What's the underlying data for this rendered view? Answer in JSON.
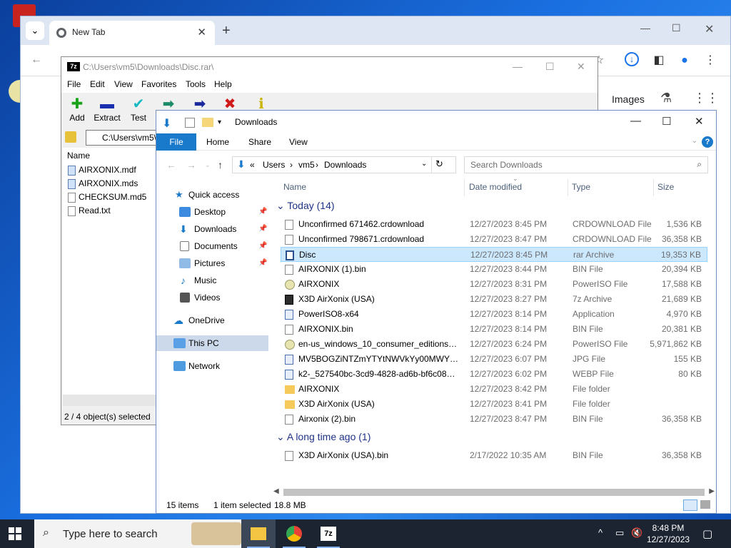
{
  "chrome": {
    "tab_title": "New Tab",
    "images_link": "Images"
  },
  "sevenzip": {
    "title": "C:\\Users\\vm5\\Downloads\\Disc.rar\\",
    "logo_text": "7z",
    "menu": [
      "File",
      "Edit",
      "View",
      "Favorites",
      "Tools",
      "Help"
    ],
    "tools": [
      {
        "label": "Add",
        "glyph": "✚",
        "color": "#19a319"
      },
      {
        "label": "Extract",
        "glyph": "▬",
        "color": "#1a2fb0"
      },
      {
        "label": "Test",
        "glyph": "✔",
        "color": "#16b9c4"
      },
      {
        "label": "",
        "glyph": "➡",
        "color": "#1d8b6a"
      },
      {
        "label": "",
        "glyph": "➡",
        "color": "#1a2a9e"
      },
      {
        "label": "",
        "glyph": "✖",
        "color": "#d11b1b"
      },
      {
        "label": "",
        "glyph": "ℹ",
        "color": "#c9b400"
      }
    ],
    "address": "C:\\Users\\vm5\\",
    "column_name": "Name",
    "files": [
      {
        "name": "AIRXONIX.mdf",
        "kind": "disc"
      },
      {
        "name": "AIRXONIX.mds",
        "kind": "disc"
      },
      {
        "name": "CHECKSUM.md5",
        "kind": "txt"
      },
      {
        "name": "Read.txt",
        "kind": "txt"
      }
    ],
    "status": "2 / 4 object(s) selected"
  },
  "explorer": {
    "title": "Downloads",
    "ribbon": {
      "file": "File",
      "home": "Home",
      "share": "Share",
      "view": "View"
    },
    "address": {
      "prefix": "«",
      "parts": [
        "Users",
        "vm5",
        "Downloads"
      ]
    },
    "search_placeholder": "Search Downloads",
    "nav": {
      "quick_access": "Quick access",
      "desktop": "Desktop",
      "downloads": "Downloads",
      "documents": "Documents",
      "pictures": "Pictures",
      "music": "Music",
      "videos": "Videos",
      "onedrive": "OneDrive",
      "this_pc": "This PC",
      "network": "Network"
    },
    "columns": {
      "name": "Name",
      "date": "Date modified",
      "type": "Type",
      "size": "Size"
    },
    "groups": [
      {
        "label": "Today (14)",
        "rows": [
          {
            "name": "Unconfirmed 671462.crdownload",
            "date": "12/27/2023 8:45 PM",
            "type": "CRDOWNLOAD File",
            "size": "1,536 KB",
            "icon": "doc"
          },
          {
            "name": "Unconfirmed 798671.crdownload",
            "date": "12/27/2023 8:47 PM",
            "type": "CRDOWNLOAD File",
            "size": "36,358 KB",
            "icon": "doc"
          },
          {
            "name": "Disc",
            "date": "12/27/2023 8:45 PM",
            "type": "rar Archive",
            "size": "19,353 KB",
            "icon": "rar",
            "selected": true
          },
          {
            "name": "AIRXONIX (1).bin",
            "date": "12/27/2023 8:44 PM",
            "type": "BIN File",
            "size": "20,394 KB",
            "icon": "doc"
          },
          {
            "name": "AIRXONIX",
            "date": "12/27/2023 8:31 PM",
            "type": "PowerISO File",
            "size": "17,588 KB",
            "icon": "disc"
          },
          {
            "name": "X3D AirXonix (USA)",
            "date": "12/27/2023 8:27 PM",
            "type": "7z Archive",
            "size": "21,689 KB",
            "icon": "zip"
          },
          {
            "name": "PowerISO8-x64",
            "date": "12/27/2023 8:14 PM",
            "type": "Application",
            "size": "4,970 KB",
            "icon": "img"
          },
          {
            "name": "AIRXONIX.bin",
            "date": "12/27/2023 8:14 PM",
            "type": "BIN File",
            "size": "20,381 KB",
            "icon": "doc"
          },
          {
            "name": "en-us_windows_10_consumer_editions_v...",
            "date": "12/27/2023 6:24 PM",
            "type": "PowerISO File",
            "size": "5,971,862 KB",
            "icon": "disc"
          },
          {
            "name": "MV5BOGZiNTZmYTYtNWVkYy00MWY0L...",
            "date": "12/27/2023 6:07 PM",
            "type": "JPG File",
            "size": "155 KB",
            "icon": "img"
          },
          {
            "name": "k2-_527540bc-3cd9-4828-ad6b-bf6c0899...",
            "date": "12/27/2023 6:02 PM",
            "type": "WEBP File",
            "size": "80 KB",
            "icon": "img"
          },
          {
            "name": "AIRXONIX",
            "date": "12/27/2023 8:42 PM",
            "type": "File folder",
            "size": "",
            "icon": "folder"
          },
          {
            "name": "X3D AirXonix (USA)",
            "date": "12/27/2023 8:41 PM",
            "type": "File folder",
            "size": "",
            "icon": "folder"
          },
          {
            "name": "Airxonix (2).bin",
            "date": "12/27/2023 8:47 PM",
            "type": "BIN File",
            "size": "36,358 KB",
            "icon": "doc"
          }
        ]
      },
      {
        "label": "A long time ago (1)",
        "rows": [
          {
            "name": "X3D AirXonix (USA).bin",
            "date": "2/17/2022 10:35 AM",
            "type": "BIN File",
            "size": "36,358 KB",
            "icon": "doc"
          }
        ]
      }
    ],
    "status": {
      "items": "15 items",
      "selected": "1 item selected",
      "size": "18.8 MB"
    }
  },
  "taskbar": {
    "search_placeholder": "Type here to search",
    "time": "8:48 PM",
    "date": "12/27/2023"
  }
}
